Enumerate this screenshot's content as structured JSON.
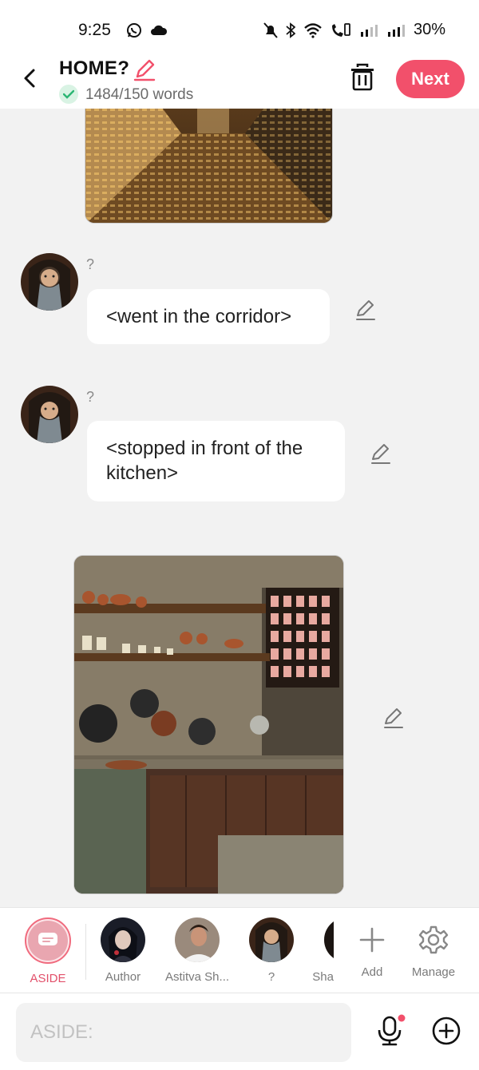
{
  "status_bar": {
    "time": "9:25",
    "battery": "30%",
    "icons": [
      "whatsapp-icon",
      "cloud-icon",
      "mute-icon",
      "bluetooth-icon",
      "wifi-icon",
      "call-icon",
      "signal-icon",
      "signal-icon",
      "battery-icon"
    ]
  },
  "header": {
    "title": "HOME?",
    "word_count": "1484/150 words",
    "next_label": "Next",
    "accent_color": "#f2506b"
  },
  "messages": [
    {
      "type": "image",
      "subject": "sunlit corridor"
    },
    {
      "type": "text",
      "speaker": "?",
      "text": "<went in the corridor>"
    },
    {
      "type": "text",
      "speaker": "?",
      "text": "<stopped in front of the kitchen>"
    },
    {
      "type": "image",
      "subject": "kitchen"
    }
  ],
  "characters": [
    {
      "label": "ASIDE",
      "active": true
    },
    {
      "label": "Author"
    },
    {
      "label": "Astitva Sh..."
    },
    {
      "label": "?"
    },
    {
      "label": "Sha"
    },
    {
      "label": "Add",
      "icon": "plus-icon"
    },
    {
      "label": "Manage",
      "icon": "gear-icon"
    }
  ],
  "composer": {
    "placeholder": "ASIDE:"
  }
}
